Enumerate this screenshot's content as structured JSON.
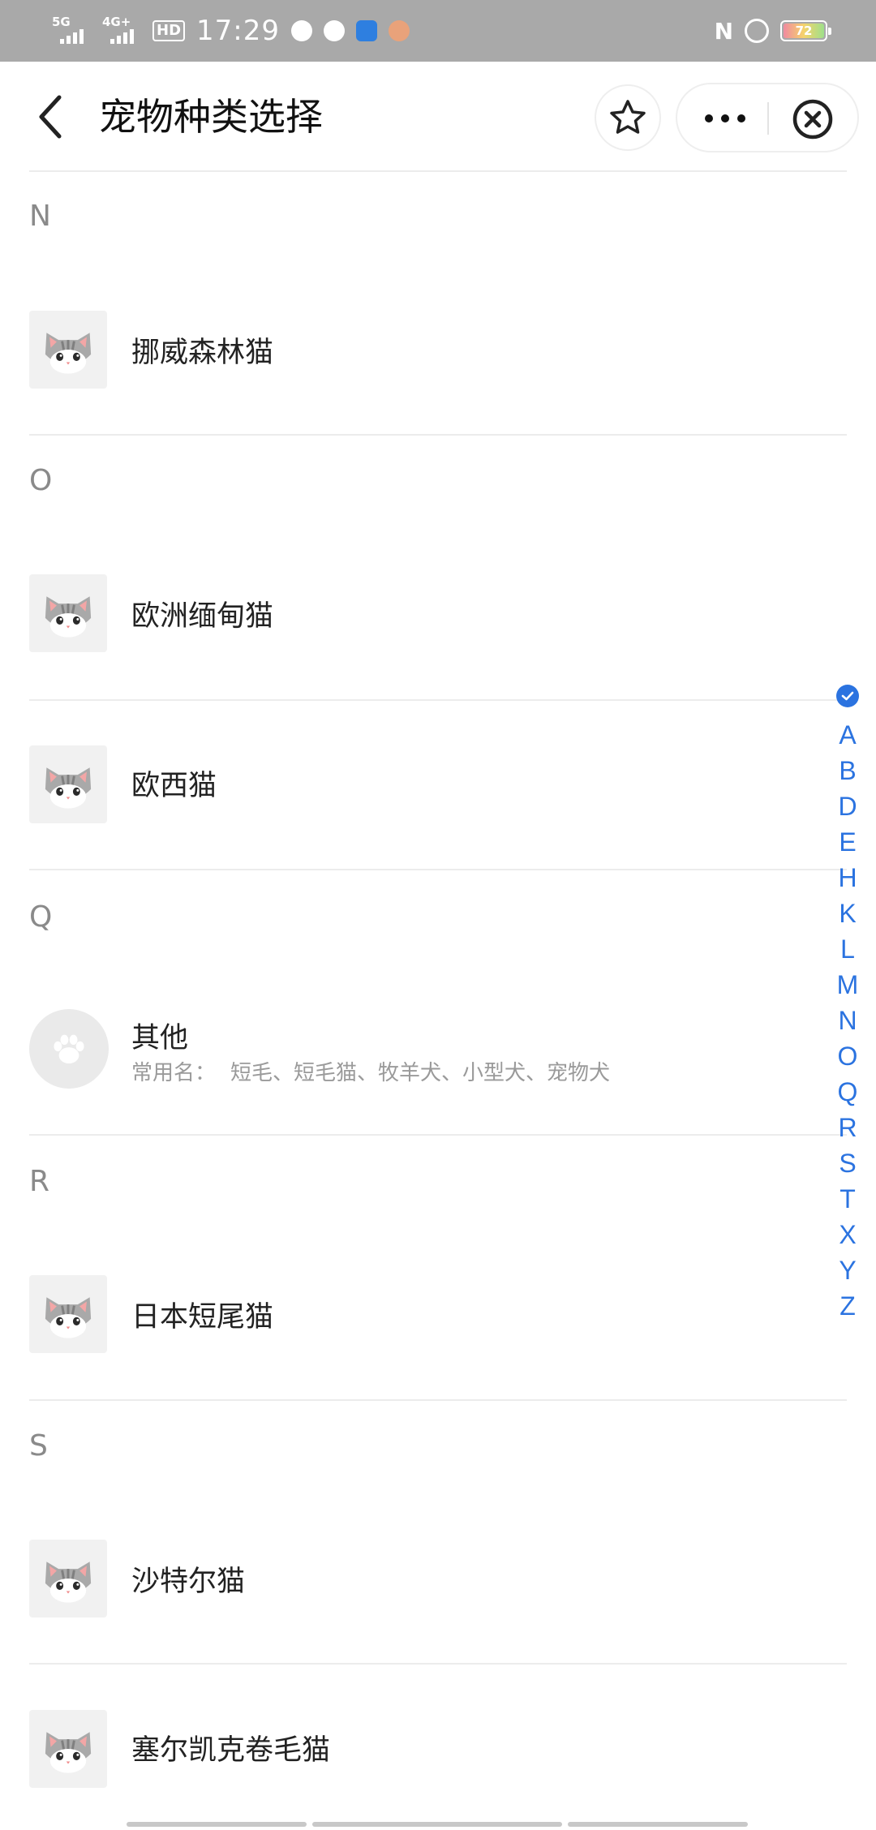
{
  "status_bar": {
    "network1": "5G",
    "network2": "4G+",
    "hd": "HD",
    "time": "17:29",
    "nfc": "N",
    "battery": "72"
  },
  "nav": {
    "title": "宠物种类选择"
  },
  "sections": [
    {
      "letter": "N",
      "items": [
        {
          "name": "挪威森林猫",
          "icon": "cat-icon"
        }
      ]
    },
    {
      "letter": "O",
      "items": [
        {
          "name": "欧洲缅甸猫",
          "icon": "cat-icon"
        },
        {
          "name": "欧西猫",
          "icon": "cat-icon"
        }
      ]
    },
    {
      "letter": "Q",
      "items": [
        {
          "name": "其他",
          "icon": "paw-icon",
          "sub_label": "常用名：",
          "sub_value": "短毛、短毛猫、牧羊犬、小型犬、宠物犬"
        }
      ]
    },
    {
      "letter": "R",
      "items": [
        {
          "name": "日本短尾猫",
          "icon": "cat-icon"
        }
      ]
    },
    {
      "letter": "S",
      "items": [
        {
          "name": "沙特尔猫",
          "icon": "cat-icon"
        },
        {
          "name": "塞尔凯克卷毛猫",
          "icon": "cat-icon"
        }
      ]
    }
  ],
  "index_letters": [
    "A",
    "B",
    "D",
    "E",
    "H",
    "K",
    "L",
    "M",
    "N",
    "O",
    "Q",
    "R",
    "S",
    "T",
    "X",
    "Y",
    "Z"
  ],
  "colors": {
    "accent": "#2b73e0",
    "status_bar_bg": "#a9a9a9",
    "divider": "#ececec"
  }
}
